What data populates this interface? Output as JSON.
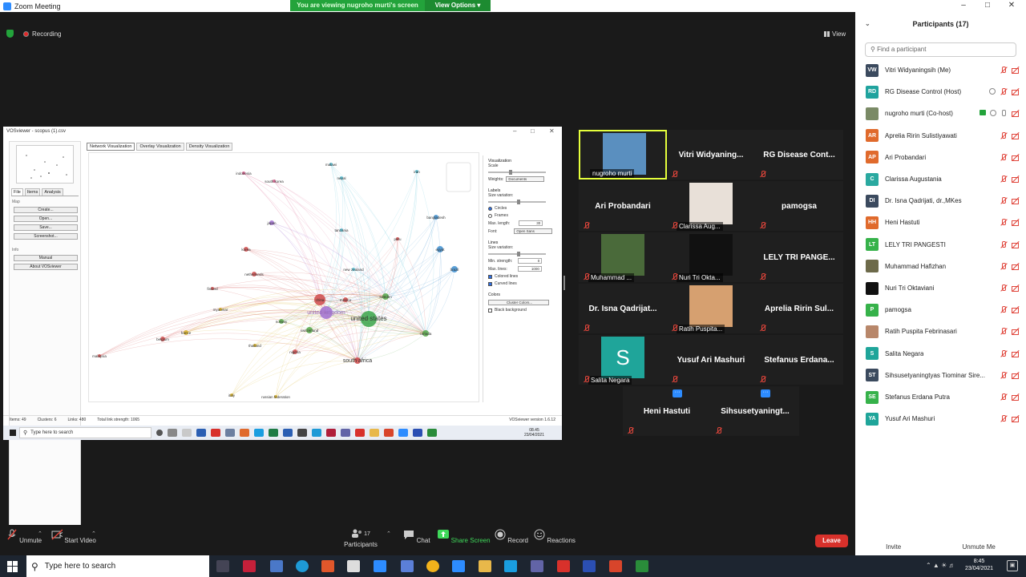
{
  "window": {
    "title": "Zoom Meeting"
  },
  "banner": {
    "viewing": "You are viewing nugroho murti's screen",
    "view_options": "View Options"
  },
  "status": {
    "recording": "Recording",
    "view": "View"
  },
  "vosviewer": {
    "title": "VOSviewer - scopus (1).csv",
    "tabs": [
      "Network Visualization",
      "Overlay Visualization",
      "Density Visualization"
    ],
    "left_tabs": [
      "File",
      "Items",
      "Analysis"
    ],
    "map_group": "Map",
    "buttons": [
      "Create...",
      "Open...",
      "Save...",
      "Screenshot..."
    ],
    "info_group": "Info",
    "info_buttons": [
      "Manual",
      "About VOSviewer"
    ],
    "nodes": [
      {
        "label": "malawi",
        "color": "#58c1d6"
      },
      {
        "label": "nepal",
        "color": "#58c1d6"
      },
      {
        "label": "indonesia",
        "color": "#d65a8a"
      },
      {
        "label": "south korea",
        "color": "#d65a8a"
      },
      {
        "label": "iran",
        "color": "#58c1d6"
      },
      {
        "label": "japan",
        "color": "#a070d0"
      },
      {
        "label": "bangladesh",
        "color": "#3e8fd0"
      },
      {
        "label": "tanzania",
        "color": "#58c1d6"
      },
      {
        "label": "peru",
        "color": "#d04a4a"
      },
      {
        "label": "korea",
        "color": "#d04a4a"
      },
      {
        "label": "brazil",
        "color": "#3e8fd0"
      },
      {
        "label": "egypt",
        "color": "#3e8fd0"
      },
      {
        "label": "netherlands",
        "color": "#d04a4a"
      },
      {
        "label": "new zealand",
        "color": "#58c1d6"
      },
      {
        "label": "finland",
        "color": "#d04a4a"
      },
      {
        "label": "china",
        "color": "#d04a4a"
      },
      {
        "label": "mexico",
        "color": "#d04a4a"
      },
      {
        "label": "sweden",
        "color": "#58a84a"
      },
      {
        "label": "myanmar",
        "color": "#d8b020"
      },
      {
        "label": "united kingdom",
        "color": "#a070d0"
      },
      {
        "label": "united states",
        "color": "#3aa64a"
      },
      {
        "label": "norway",
        "color": "#58a84a"
      },
      {
        "label": "switzerland",
        "color": "#58a84a"
      },
      {
        "label": "canada",
        "color": "#58a84a"
      },
      {
        "label": "france",
        "color": "#d8b020"
      },
      {
        "label": "belgium",
        "color": "#d04a4a"
      },
      {
        "label": "thailand",
        "color": "#d8b020"
      },
      {
        "label": "nigeria",
        "color": "#d04a4a"
      },
      {
        "label": "malaysia",
        "color": "#d04a4a"
      },
      {
        "label": "south africa",
        "color": "#d04a4a"
      },
      {
        "label": "italy",
        "color": "#d8b020"
      },
      {
        "label": "russian federation",
        "color": "#d8b020"
      }
    ],
    "panel": {
      "visualization": "Visualization",
      "scale": "Scale",
      "weights_label": "Weights:",
      "weights_value": "Documents",
      "labels": "Labels",
      "size_variation": "Size variation:",
      "circles": "Circles",
      "frames": "Frames",
      "max_length_label": "Max. length:",
      "max_length_value": "30",
      "font_label": "Font:",
      "font_value": "Open Sans",
      "lines": "Lines",
      "lines_size_variation": "Size variation:",
      "min_strength_label": "Min. strength:",
      "min_strength_value": "0",
      "max_lines_label": "Max. lines:",
      "max_lines_value": "1000",
      "colored_lines": "Colored lines",
      "curved_lines": "Curved lines",
      "colors": "Colors",
      "cluster_colors": "Cluster Colors...",
      "black_background": "Black background"
    },
    "status": {
      "items": "Items: 49",
      "clusters": "Clusters: 6",
      "links": "Links: 480",
      "strength": "Total link strength: 1065",
      "version": "VOSviewer version 1.6.12"
    },
    "inner_taskbar": {
      "search": "Type here to search",
      "time": "08.45",
      "date": "23/04/2021"
    }
  },
  "gallery": [
    {
      "name": "nugroho murti",
      "type": "video",
      "active": true
    },
    {
      "name": "Vitri  Widyaning...",
      "type": "name"
    },
    {
      "name": "RG Disease Cont...",
      "type": "name"
    },
    {
      "name": "Ari Probandari",
      "type": "name"
    },
    {
      "name": "Clarissa Aug...",
      "type": "video"
    },
    {
      "name": "pamogsa",
      "type": "name"
    },
    {
      "name": "Muhammad ...",
      "type": "video"
    },
    {
      "name": "Nuri Tri Okta...",
      "type": "video"
    },
    {
      "name": "LELY TRI PANGE...",
      "type": "name"
    },
    {
      "name": "Dr. Isna Qadrijat...",
      "type": "name"
    },
    {
      "name": "Ratih Puspita...",
      "type": "video"
    },
    {
      "name": "Aprelia Ririn Sul...",
      "type": "name"
    },
    {
      "name": "Salita Negara",
      "type": "avatar",
      "initial": "S"
    },
    {
      "name": "Yusuf Ari Mashuri",
      "type": "name"
    },
    {
      "name": "Stefanus Erdana...",
      "type": "name"
    },
    {
      "name": "Heni Hastuti",
      "type": "name",
      "more": "···"
    },
    {
      "name": "Sihsusetyaningt...",
      "type": "name",
      "more": "···"
    }
  ],
  "participants": {
    "title": "Participants (17)",
    "search_placeholder": "Find a participant",
    "list": [
      {
        "initials": "VW",
        "name": "Vitri Widyaningsih (Me)",
        "color": "#3b4a5e"
      },
      {
        "initials": "RD",
        "name": "RG Disease Control (Host)",
        "color": "#20a39e"
      },
      {
        "initials": "",
        "name": "nugroho murti (Co-host)",
        "color": "#7a8a66"
      },
      {
        "initials": "AR",
        "name": "Aprelia Ririn Sulistiyawati",
        "color": "#e06a2c"
      },
      {
        "initials": "AP",
        "name": "Ari Probandari",
        "color": "#e06a2c"
      },
      {
        "initials": "C",
        "name": "Clarissa Augustania",
        "color": "#2aa9a0"
      },
      {
        "initials": "DI",
        "name": "Dr. Isna Qadrijati, dr.,MKes",
        "color": "#3b4a5e"
      },
      {
        "initials": "HH",
        "name": "Heni Hastuti",
        "color": "#e06a2c"
      },
      {
        "initials": "LT",
        "name": "LELY TRI PANGESTI",
        "color": "#36b24a"
      },
      {
        "initials": "",
        "name": "Muhammad Hafizhan",
        "color": "#6d6a4a"
      },
      {
        "initials": "",
        "name": "Nuri Tri Oktaviani",
        "color": "#111111"
      },
      {
        "initials": "P",
        "name": "pamogsa",
        "color": "#36b24a"
      },
      {
        "initials": "",
        "name": "Ratih Puspita Febrinasari",
        "color": "#b8876a"
      },
      {
        "initials": "S",
        "name": "Salita Negara",
        "color": "#1fa59a"
      },
      {
        "initials": "ST",
        "name": "Sihsusetyaningtyas Tiominar Sire...",
        "color": "#3b4a5e"
      },
      {
        "initials": "SE",
        "name": "Stefanus Erdana Putra",
        "color": "#36b24a"
      },
      {
        "initials": "YA",
        "name": "Yusuf Ari Mashuri",
        "color": "#1fa59a"
      }
    ],
    "invite": "Invite",
    "unmute_me": "Unmute Me"
  },
  "toolbar": {
    "unmute": "Unmute",
    "start_video": "Start Video",
    "participants_count": "17",
    "participants": "Participants",
    "chat": "Chat",
    "share_screen": "Share Screen",
    "record": "Record",
    "reactions": "Reactions",
    "leave": "Leave"
  },
  "taskbar": {
    "search": "Type here to search",
    "time": "8:45",
    "date": "23/04/2021"
  }
}
